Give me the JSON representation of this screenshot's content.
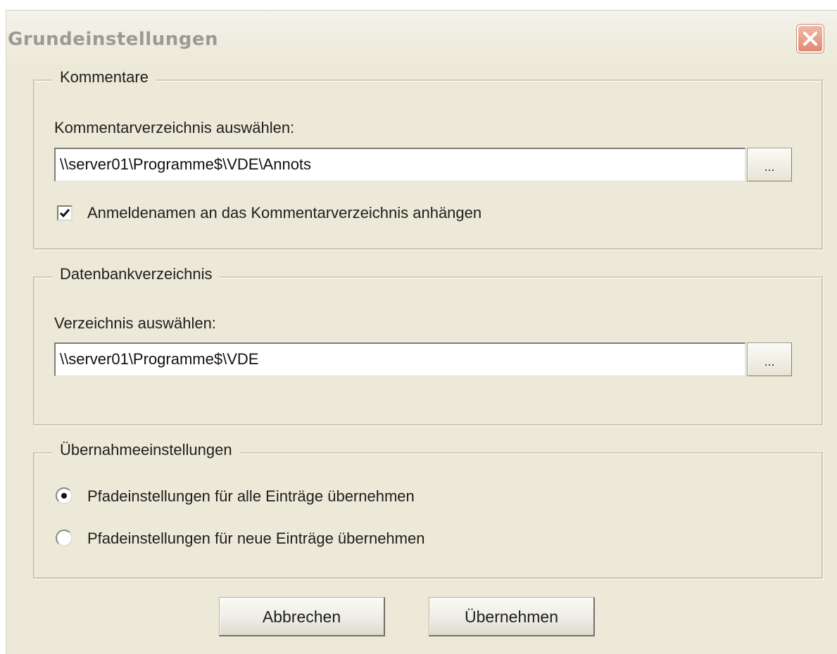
{
  "window": {
    "title": "Grundeinstellungen",
    "close_icon": "close-icon"
  },
  "comments": {
    "legend": "Kommentare",
    "label": "Kommentarverzeichnis auswählen:",
    "path_value": "\\\\server01\\Programme$\\VDE\\Annots",
    "browse_label": "...",
    "checkbox_label": "Anmeldenamen an das Kommentarverzeichnis anhängen",
    "checkbox_checked": true
  },
  "database": {
    "legend": "Datenbankverzeichnis",
    "label": "Verzeichnis auswählen:",
    "path_value": "\\\\server01\\Programme$\\VDE",
    "browse_label": "..."
  },
  "apply_settings": {
    "legend": "Übernahmeeinstellungen",
    "options": [
      {
        "label": "Pfadeinstellungen für alle Einträge übernehmen",
        "selected": true
      },
      {
        "label": "Pfadeinstellungen für neue Einträge übernehmen",
        "selected": false
      }
    ]
  },
  "buttons": {
    "cancel_label": "Abbrechen",
    "apply_label": "Übernehmen"
  },
  "colors": {
    "dialog_background": "#ece9d8",
    "close_button": "#e08a72"
  }
}
